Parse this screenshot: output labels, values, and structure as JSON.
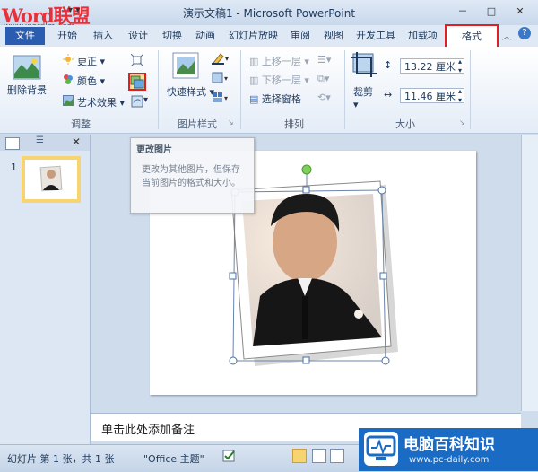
{
  "window": {
    "title": "演示文稿1 - Microsoft PowerPoint",
    "controls": [
      "－",
      "□",
      "✕"
    ],
    "help": "?"
  },
  "watermark_top": {
    "brand": "Word联盟",
    "url": "www.wordlm.com"
  },
  "tabs": [
    {
      "label": "文件"
    },
    {
      "label": "开始"
    },
    {
      "label": "插入"
    },
    {
      "label": "设计"
    },
    {
      "label": "切换"
    },
    {
      "label": "动画"
    },
    {
      "label": "幻灯片放映"
    },
    {
      "label": "审阅"
    },
    {
      "label": "视图"
    },
    {
      "label": "开发工具"
    },
    {
      "label": "加载项"
    },
    {
      "label": "格式"
    }
  ],
  "ribbon": {
    "adjust": {
      "remove_bg": "删除背景",
      "correct": "更正",
      "color": "颜色",
      "art_effects": "艺术效果",
      "label": "调整"
    },
    "picture_styles": {
      "quick_styles": "快速样式",
      "label": "图片样式"
    },
    "arrange": {
      "bring_forward": "上移一层",
      "send_backward": "下移一层",
      "selection_pane": "选择窗格",
      "label": "排列"
    },
    "size": {
      "crop": "裁剪",
      "height": "13.22 厘米",
      "width": "11.46 厘米",
      "label": "大小"
    }
  },
  "tooltip": {
    "title": "更改图片",
    "body": "更改为其他图片，但保存当前图片的格式和大小。"
  },
  "slides_panel": {
    "slide_number": "1"
  },
  "notes": {
    "placeholder": "单击此处添加备注"
  },
  "status": {
    "slide_info": "幻灯片 第 1 张，共 1 张",
    "theme": "\"Office 主题\""
  },
  "watermark_bottom": {
    "brand": "电脑百科知识",
    "url": "www.pc-daily.com"
  },
  "colors": {
    "accent_red": "#e02020",
    "file_tab": "#2a5db0",
    "thumb_highlight": "#f7d472"
  }
}
